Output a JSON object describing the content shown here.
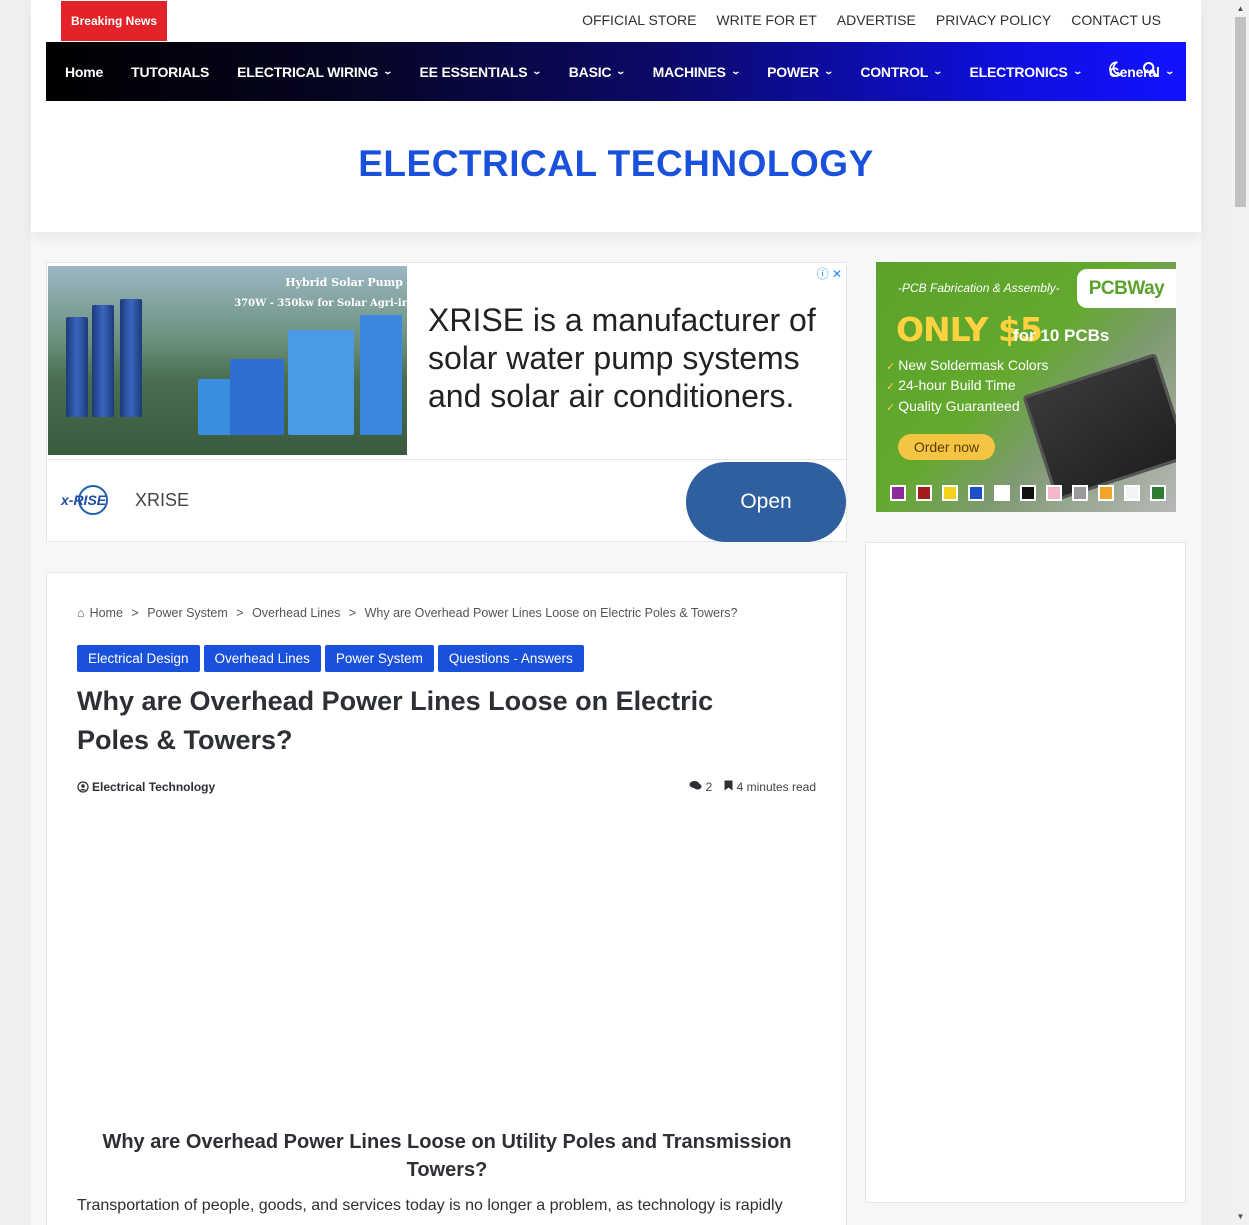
{
  "topbar": {
    "breaking_label": "Breaking News",
    "links": [
      "OFFICIAL STORE",
      "WRITE FOR ET",
      "ADVERTISE",
      "PRIVACY POLICY",
      "CONTACT US"
    ]
  },
  "nav": {
    "items": [
      {
        "label": "Home",
        "dropdown": false
      },
      {
        "label": "TUTORIALS",
        "dropdown": false
      },
      {
        "label": "ELECTRICAL WIRING",
        "dropdown": true
      },
      {
        "label": "EE ESSENTIALS",
        "dropdown": true
      },
      {
        "label": "BASIC",
        "dropdown": true
      },
      {
        "label": "MACHINES",
        "dropdown": true
      },
      {
        "label": "POWER",
        "dropdown": true
      },
      {
        "label": "CONTROL",
        "dropdown": true
      },
      {
        "label": "ELECTRONICS",
        "dropdown": true
      },
      {
        "label": "General",
        "dropdown": true
      }
    ],
    "icons": [
      "moon-icon",
      "search-icon"
    ]
  },
  "site": {
    "title": "ELECTRICAL TECHNOLOGY"
  },
  "ad1": {
    "image_caption_1": "Hybrid Solar Pump",
    "image_caption_2": "370W - 350kw for Solar Agri-ir",
    "headline": "XRISE is a manufacturer of solar water pump systems and solar air conditioners.",
    "logo_text": "x-RISE",
    "advertiser": "XRISE",
    "cta": "Open",
    "controls": [
      "info-icon",
      "close-icon"
    ]
  },
  "ad2": {
    "subtitle": "-PCB Fabrication & Assembly-",
    "brand": "PCBWay",
    "price": "ONLY $5",
    "price_suffix": "for 10 PCBs",
    "features": [
      "New Soldermask Colors",
      "24-hour Build Time",
      "Quality Guaranteed"
    ],
    "cta": "Order now",
    "swatch_colors": [
      "#8e2a9b",
      "#a31d1d",
      "#f2d21b",
      "#1f4fc8",
      "#ffffff",
      "#111111",
      "#f5b6c8",
      "#9a9a9a",
      "#f2a32a",
      "#f4f4f4",
      "#2e7d32"
    ]
  },
  "article": {
    "breadcrumbs": [
      "Home",
      "Power System",
      "Overhead Lines",
      "Why are Overhead Power Lines Loose on Electric Poles & Towers?"
    ],
    "breadcrumb_separator": ">",
    "tags": [
      "Electrical Design",
      "Overhead Lines",
      "Power System",
      "Questions - Answers"
    ],
    "title": "Why are Overhead Power Lines Loose on Electric Poles & Towers?",
    "author": "Electrical Technology",
    "comments": "2",
    "read_time": "4 minutes read",
    "subheading": "Why are Overhead Power Lines Loose on Utility Poles and Transmission Towers?",
    "body_start": "Transportation of people, goods, and services today is no longer a problem, as technology is rapidly"
  },
  "colors": {
    "accent": "#1a51dc",
    "breaking": "#e3232a",
    "nav_start": "#000000",
    "nav_end": "#1212ff",
    "open_button": "#2f5f9f"
  }
}
